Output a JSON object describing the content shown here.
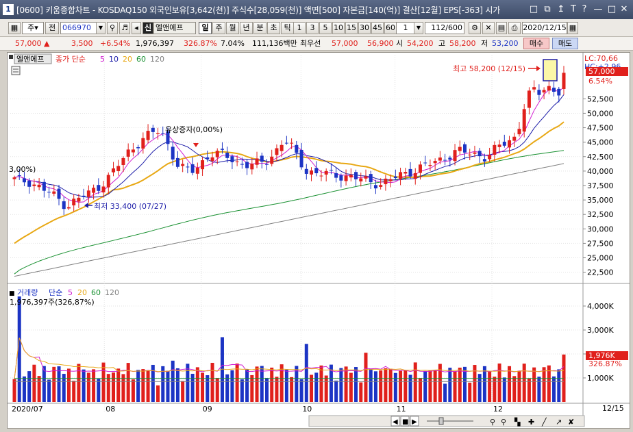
{
  "window": {
    "number": "1",
    "title": "[0600] 키움종합차트 - KOSDAQ150 외국인보유[3,642(천)] 주식수[28,059(천)] 액면[500] 자본금[140(억)] 결산[12월] EPS[-363] 시가"
  },
  "toolbar": {
    "market_selector": "주",
    "prev_label": "전",
    "stock_code": "066970",
    "stock_type_badge": "신",
    "stock_name": "엘앤에프",
    "period_buttons": [
      "일",
      "주",
      "월",
      "년",
      "분",
      "초",
      "틱"
    ],
    "selected_period": "일",
    "interval_buttons": [
      "1",
      "3",
      "5",
      "10",
      "15",
      "30",
      "45",
      "60"
    ],
    "interval_value": "1",
    "count": "112/600",
    "date": "2020/12/15"
  },
  "quote": {
    "price": "57,000",
    "change": "3,500",
    "change_pct": "+6.54%",
    "volume": "1,976,397",
    "volume_ratio": "326.87%",
    "turnover": "7.04%",
    "amount": "111,136백만",
    "best_ask_label": "최우선",
    "best_ask": "57,000",
    "best_bid": "56,900",
    "open_label": "시",
    "open": "54,200",
    "high_label": "고",
    "high": "58,200",
    "low_label": "저",
    "low": "53,200",
    "buy_label": "매수",
    "sell_label": "매도"
  },
  "price_panel": {
    "stock_name": "엘앤에프",
    "legend_title": "종가 단순",
    "ma_periods": [
      "5",
      "10",
      "20",
      "60",
      "120"
    ],
    "annotation_high": "최고 58,200 (12/15)",
    "annotation_low": "최저 33,400 (07/27)",
    "annotation_event": "유상증자(0,00%)",
    "left_partial_label": "3,00%)",
    "limit_label_top": "LC:70,66",
    "limit_label_second": "HC:+2.96",
    "current_price_tag": "57,000",
    "current_pct_tag": "6.54%"
  },
  "volume_panel": {
    "legend_title": "거래량",
    "legend_ma": "단순",
    "ma_periods": [
      "5",
      "20",
      "60",
      "120"
    ],
    "current_volume": "1,976,397주(326,87%)",
    "current_volume_tag": "1,976K",
    "current_pct_tag": "326.87%"
  },
  "x_axis": {
    "labels": [
      "2020/07",
      "08",
      "09",
      "10",
      "11",
      "12"
    ],
    "right_label": "12/15"
  },
  "colors": {
    "up": "#e0201c",
    "down": "#1c34c4",
    "ma5": "#d01cd0",
    "ma10": "#1c1ca8",
    "ma20": "#e8a814",
    "ma60": "#189030",
    "ma120": "#808080"
  },
  "chart_data": [
    {
      "type": "candlestick",
      "title": "엘앤에프",
      "yaxis_ticks": [
        "52,500",
        "50,000",
        "47,500",
        "45,000",
        "42,500",
        "40,000",
        "37,500",
        "35,000",
        "32,500",
        "30,000",
        "27,500",
        "25,000",
        "22,500"
      ],
      "ylim": [
        20800,
        60000
      ],
      "annotations": {
        "high": {
          "date": "12/15",
          "value": 58200
        },
        "low": {
          "date": "07/27",
          "value": 33400
        }
      },
      "last": {
        "open": 54200,
        "high": 58200,
        "low": 53200,
        "close": 57000
      },
      "ma_tail": {
        "ma5": 54000,
        "ma10": 52000,
        "ma20": 50000,
        "ma60": 43600,
        "ma120": 41300
      }
    },
    {
      "type": "bar",
      "title": "거래량",
      "yaxis_ticks": [
        "4,000K",
        "3,000K",
        "2,000K",
        "1,000K"
      ],
      "ylim": [
        0,
        4800000
      ],
      "last_volume": 1976397
    }
  ]
}
